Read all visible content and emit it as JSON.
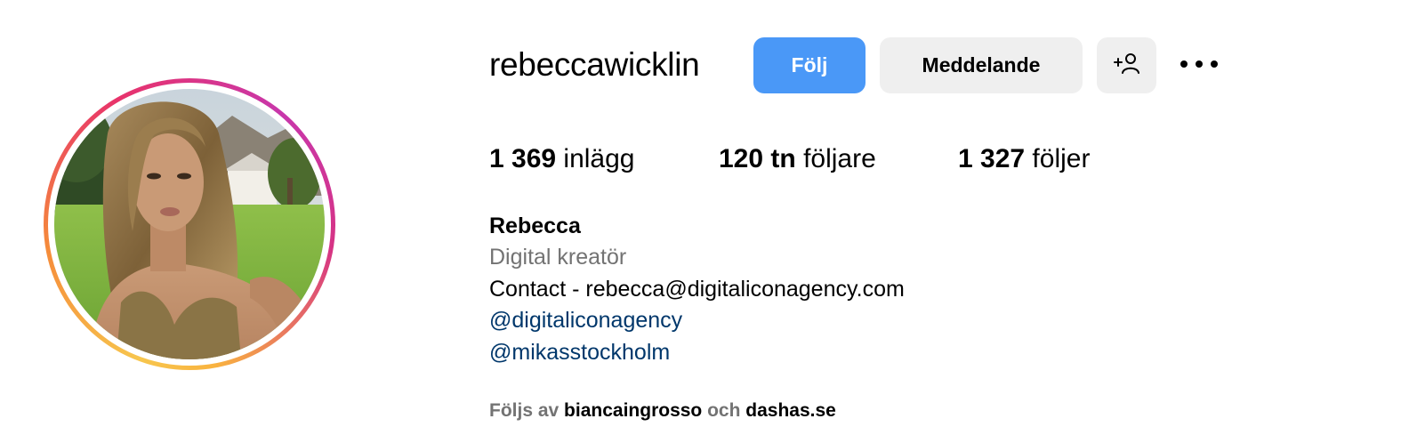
{
  "profile": {
    "username": "rebeccawicklin",
    "avatar_icon": "profile-photo",
    "ring_colors": [
      "#f7c64e",
      "#f58b3a",
      "#e8336b",
      "#c837ab"
    ]
  },
  "actions": {
    "follow_label": "Följ",
    "message_label": "Meddelande",
    "suggest_icon": "add-person-icon",
    "more_icon": "more-options-icon",
    "follow_color": "#4a98f7"
  },
  "stats": {
    "posts_count": "1 369",
    "posts_label": "inlägg",
    "followers_count": "120 tn",
    "followers_label": "följare",
    "following_count": "1 327",
    "following_label": "följer"
  },
  "bio": {
    "name": "Rebecca",
    "category": "Digital kreatör",
    "text": "Contact - rebecca@digitaliconagency.com",
    "links": [
      "@digitaliconagency",
      "@mikasstockholm"
    ],
    "link_color": "#00376b"
  },
  "followed_by": {
    "prefix": "Följs av",
    "user1": "biancaingrosso",
    "joiner": "och",
    "user2": "dashas.se"
  }
}
